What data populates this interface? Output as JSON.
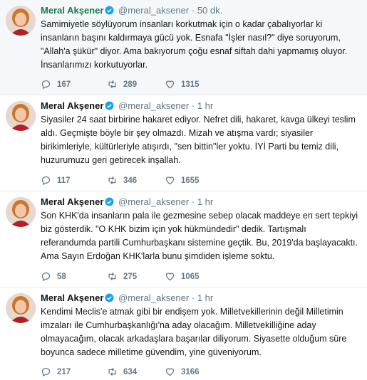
{
  "tweets": [
    {
      "name": "Meral Akşener",
      "handle": "@meral_aksener",
      "dot": "·",
      "time": "50 dk.",
      "text": "Samimiyetle söylüyorum insanları korkutmak için o kadar çabalıyorlar ki insanların başını kaldırmaya gücü yok. Esnafa \"İşler nasıl?\" diye soruyorum, \"Allah'a şükür\" diyor. Ama bakıyorum çoğu esnaf siftah dahi yapmamış oluyor. İnsanlarımızı korkutuyorlar.",
      "replies": "167",
      "retweets": "289",
      "likes": "1315"
    },
    {
      "name": "Meral Akşener",
      "handle": "@meral_aksener",
      "dot": "·",
      "time": "1 hr",
      "text": "Siyasiler 24 saat birbirine hakaret ediyor. Nefret dili, hakaret, kavga ülkeyi teslim aldı. Geçmişte böyle bir şey olmazdı. Mizah ve atışma vardı; siyasiler birikimleriyle, kültürleriyle atışırdı, \"sen bittin\"ler yoktu. İYİ Parti bu temiz dili, huzurumuzu geri getirecek inşallah.",
      "replies": "117",
      "retweets": "346",
      "likes": "1655"
    },
    {
      "name": "Meral Akşener",
      "handle": "@meral_aksener",
      "dot": "·",
      "time": "1 hr",
      "text": "Son KHK'da insanların pala ile gezmesine sebep olacak maddeye en sert tepkiyi biz gösterdik. \"O KHK bizim için yok hükmündedir\" dedik. Tartışmalı referandumda partili Cumhurbaşkanı sistemine geçtik. Bu, 2019'da başlayacaktı. Ama Sayın Erdoğan KHK'larla bunu şimdiden işleme soktu.",
      "replies": "58",
      "retweets": "275",
      "likes": "1065"
    },
    {
      "name": "Meral Akşener",
      "handle": "@meral_aksener",
      "dot": "·",
      "time": "1 hr",
      "text": "Kendimi Meclis'e atmak gibi bir endişem yok. Milletvekillerinin değil Milletimin imzaları ile Cumhurbaşkanlığı'na aday olacağım. Milletvekilliğine aday olmayacağım, olacak arkadaşlara başarılar diliyorum. Siyasette olduğum süre boyunca sadece milletime güvendim, yine güveniyorum.",
      "replies": "217",
      "retweets": "634",
      "likes": "3166"
    }
  ],
  "colors": {
    "verified": "#1da1f2",
    "highlight_name": "#1b7a4b",
    "muted": "#657786"
  }
}
